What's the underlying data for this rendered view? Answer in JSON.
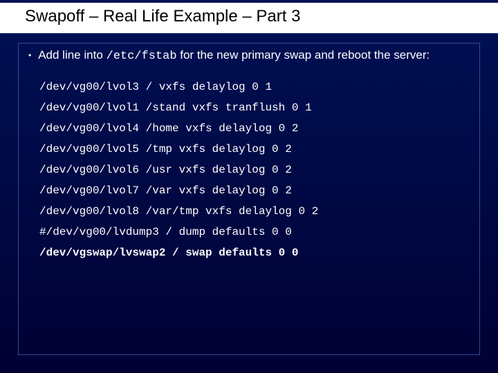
{
  "slide": {
    "title": "Swapoff – Real Life Example – Part 3",
    "bullet": {
      "pre": "Add line into ",
      "code": "/etc/fstab",
      "post": " for the new primary swap and reboot the server:"
    },
    "fstab": [
      {
        "text": "/dev/vg00/lvol3 / vxfs delaylog 0 1",
        "bold": false
      },
      {
        "text": "/dev/vg00/lvol1 /stand vxfs tranflush 0 1",
        "bold": false
      },
      {
        "text": "/dev/vg00/lvol4 /home vxfs delaylog 0 2",
        "bold": false
      },
      {
        "text": "/dev/vg00/lvol5 /tmp vxfs delaylog 0 2",
        "bold": false
      },
      {
        "text": "/dev/vg00/lvol6 /usr vxfs delaylog 0 2",
        "bold": false
      },
      {
        "text": "/dev/vg00/lvol7 /var vxfs delaylog 0 2",
        "bold": false
      },
      {
        "text": "/dev/vg00/lvol8 /var/tmp vxfs delaylog 0 2",
        "bold": false
      },
      {
        "text": "#/dev/vg00/lvdump3 / dump defaults 0 0",
        "bold": false
      },
      {
        "text": "/dev/vgswap/lvswap2 / swap defaults 0 0",
        "bold": true
      }
    ]
  }
}
